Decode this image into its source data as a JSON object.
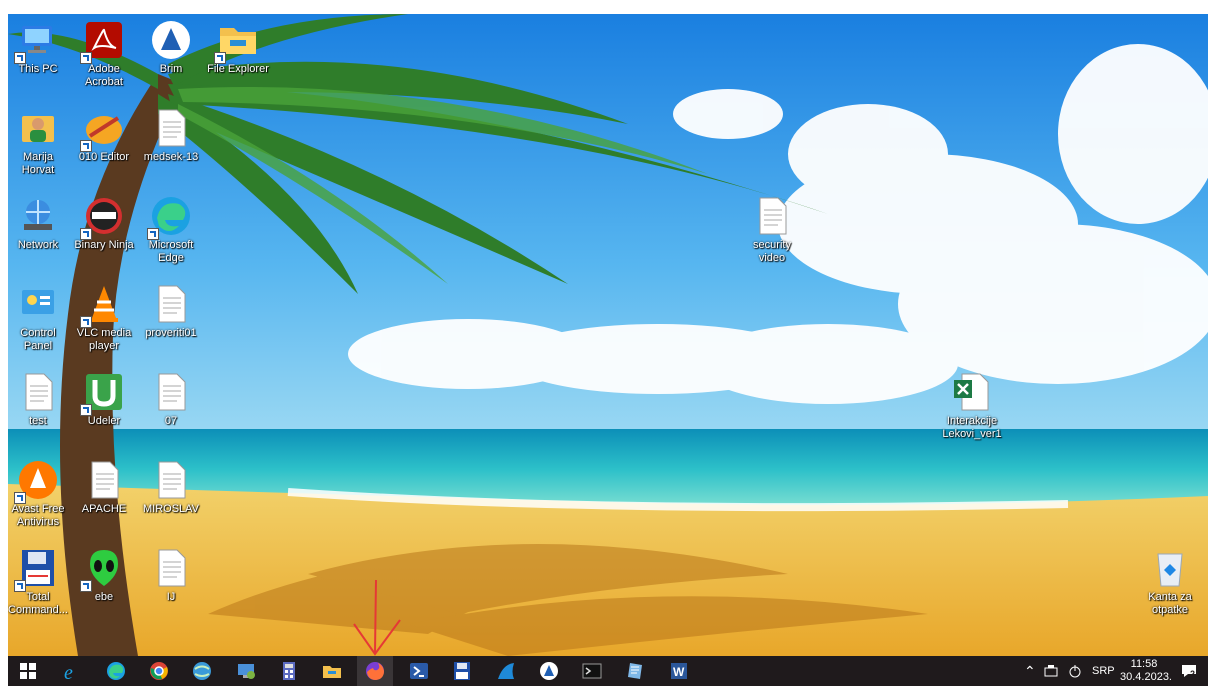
{
  "desktop": {
    "icons": [
      {
        "name": "this-pc",
        "label": "This PC"
      },
      {
        "name": "adobe-acrobat",
        "label": "Adobe Acrobat"
      },
      {
        "name": "brim",
        "label": "Brim"
      },
      {
        "name": "file-explorer",
        "label": "File Explorer"
      },
      {
        "name": "marija-horvat",
        "label": "Marija Horvat"
      },
      {
        "name": "010-editor",
        "label": "010 Editor"
      },
      {
        "name": "medsek-13",
        "label": "medsek-13"
      },
      {
        "name": "network",
        "label": "Network"
      },
      {
        "name": "binary-ninja",
        "label": "Binary Ninja"
      },
      {
        "name": "microsoft-edge",
        "label": "Microsoft Edge"
      },
      {
        "name": "control-panel",
        "label": "Control Panel"
      },
      {
        "name": "vlc-media-player",
        "label": "VLC media player"
      },
      {
        "name": "proveriti01",
        "label": "proveriti01"
      },
      {
        "name": "test",
        "label": "test"
      },
      {
        "name": "udeler",
        "label": "Udeler"
      },
      {
        "name": "07",
        "label": "07"
      },
      {
        "name": "avast-free-antivirus",
        "label": "Avast Free Antivirus"
      },
      {
        "name": "apache",
        "label": "APACHE"
      },
      {
        "name": "miroslav",
        "label": "MIROSLAV"
      },
      {
        "name": "total-commander",
        "label": "Total Command..."
      },
      {
        "name": "ebe",
        "label": "ebe"
      },
      {
        "name": "ij",
        "label": "IJ"
      },
      {
        "name": "security-video",
        "label": "security video"
      },
      {
        "name": "interakcije-lekovi",
        "label": "Interakcije Lekovi_ver1"
      },
      {
        "name": "recycle-bin",
        "label": "Kanta za otpatke"
      }
    ]
  },
  "taskbar": {
    "apps": [
      "start-icon",
      "internet-explorer-icon",
      "edge-icon",
      "chrome-icon",
      "network-globe-icon",
      "remote-desktop-icon",
      "calculator-icon",
      "file-explorer-icon",
      "firefox-icon",
      "powershell-icon",
      "save-disk-icon",
      "sharp-app-icon",
      "brim-icon",
      "terminal-icon",
      "notepad-icon",
      "word-icon"
    ],
    "tray": {
      "language": "SRP",
      "time": "11:58",
      "date": "30.4.2023.",
      "notifications_count": "2"
    }
  },
  "colors": {
    "sky": "#1e90ff",
    "sea": "#1fb7c8",
    "sand": "#f5c542",
    "taskbar": "#1f1a1c",
    "annotation": "#e53935"
  }
}
